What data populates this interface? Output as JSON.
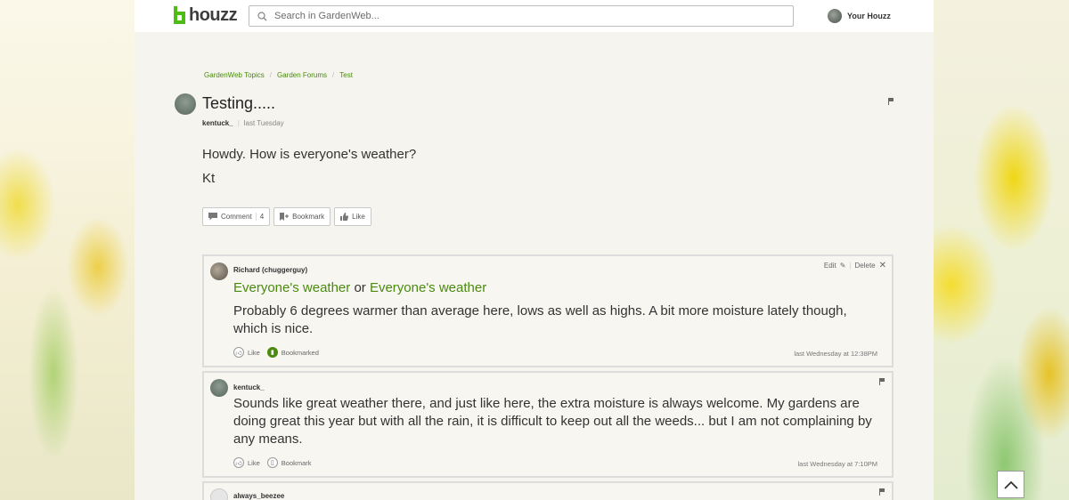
{
  "header": {
    "logo_text": "houzz",
    "search_placeholder": "Search in GardenWeb...",
    "your_houzz": "Your Houzz"
  },
  "breadcrumb": {
    "items": [
      "GardenWeb Topics",
      "Garden Forums",
      "Test"
    ],
    "separator": "/"
  },
  "post": {
    "title": "Testing.....",
    "author": "kentuck_",
    "time": "last Tuesday",
    "body_lines": [
      "Howdy. How is everyone's weather?",
      "Kt"
    ],
    "actions": {
      "comment_label": "Comment",
      "comment_count": "4",
      "bookmark_label": "Bookmark",
      "like_label": "Like"
    }
  },
  "comments": [
    {
      "author": "Richard (chuggerguy)",
      "link_1": "Everyone's weather",
      "link_joiner": "or",
      "link_2": "Everyone's weather",
      "text": "Probably 6 degrees warmer than average here, lows as well as highs. A bit more moisture lately though, which is nice.",
      "like_label": "Like",
      "bookmark_label": "Bookmarked",
      "time": "last Wednesday at 12:38PM",
      "edit_label": "Edit",
      "delete_label": "Delete"
    },
    {
      "author": "kentuck_",
      "text": "Sounds like great weather there, and just like here, the extra moisture is always welcome. My gardens are doing great this year but with all the rain, it is difficult to keep out all the weeds... but I am not complaining by any means.",
      "like_label": "Like",
      "bookmark_label": "Bookmark",
      "time": "last Wednesday at 7:10PM"
    },
    {
      "author": "always_beezee"
    }
  ],
  "colors": {
    "brand_green": "#4dbc15",
    "link_green": "#4a8a0e"
  }
}
